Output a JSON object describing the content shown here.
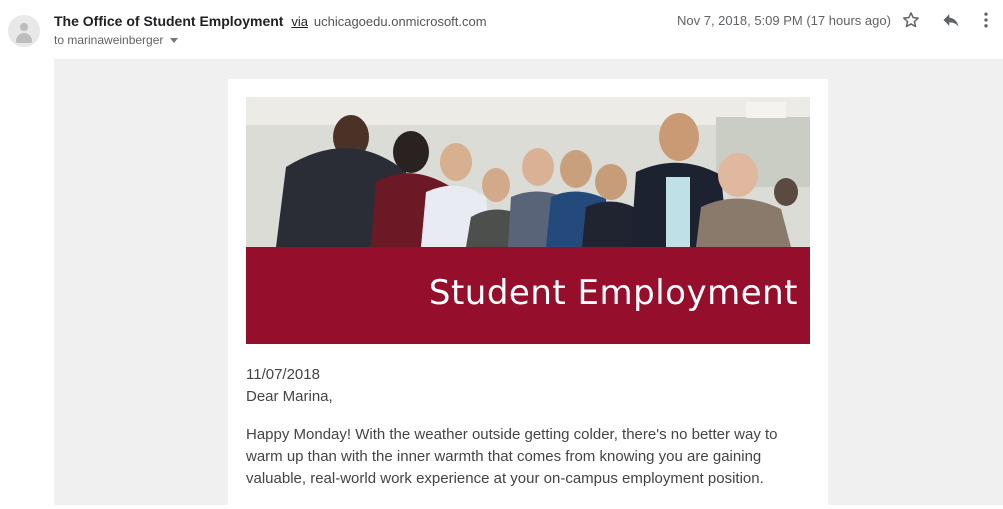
{
  "header": {
    "sender_name": "The Office of Student Employment",
    "via_label": "via",
    "sender_domain": "uchicagoedu.onmicrosoft.com",
    "to_label": "to marinaweinberger",
    "date": "Nov 7, 2018, 5:09 PM (17 hours ago)"
  },
  "icons": {
    "avatar": "default-avatar-icon",
    "star": "star-icon",
    "reply": "reply-icon",
    "more": "more-vert-icon",
    "recipients": "chevron-down-icon"
  },
  "email": {
    "banner_title": "Student Employment",
    "date_line": "11/07/2018",
    "greeting": "Dear Marina,",
    "paragraph": "Happy Monday! With the weather outside getting colder, there's no better way to warm up than with the inner warmth that comes from knowing you are gaining valuable, real-world work experience at your on-campus employment position."
  },
  "colors": {
    "brand_maroon": "#8e0d2a",
    "canvas_gray": "#f0f0f0"
  }
}
